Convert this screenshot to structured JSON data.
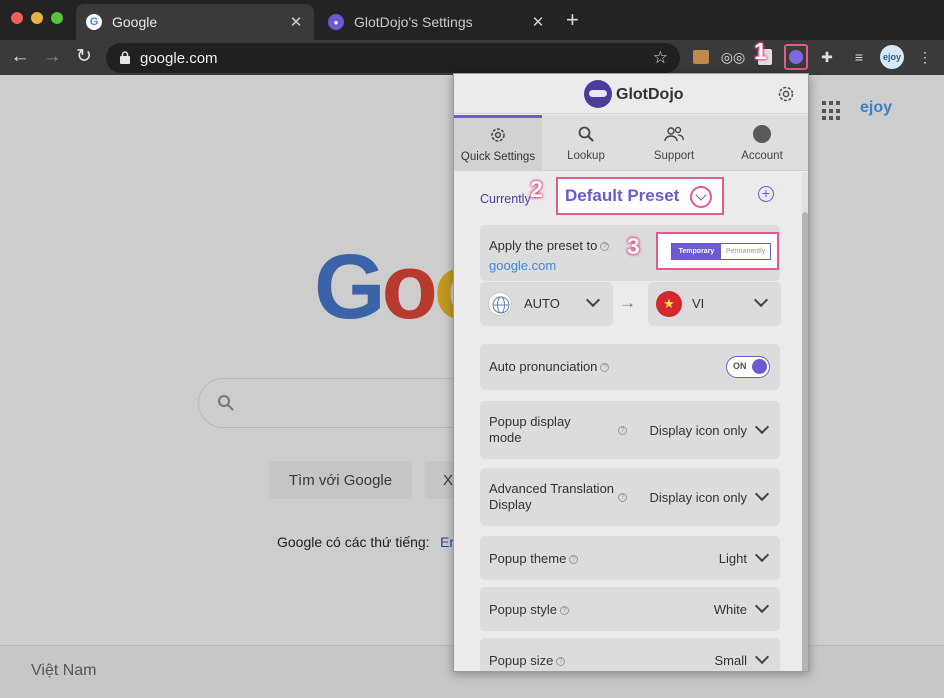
{
  "browser": {
    "tabs": [
      {
        "title": "Google",
        "favicon": "google-g-icon",
        "active": true
      },
      {
        "title": "GlotDojo's Settings",
        "favicon": "glotdojo-ninja-icon",
        "active": false
      }
    ],
    "new_tab_symbol": "+",
    "tab_close_symbol": "✕",
    "address": "google.com",
    "star_symbol": "☆",
    "avatar_text": "ejoy",
    "annotations": {
      "step1": "1",
      "step2": "2",
      "step3": "3"
    }
  },
  "google": {
    "logo_letters": [
      "G",
      "o",
      "o"
    ],
    "search_button": "Tìm với Google",
    "second_button_partial": "X",
    "languages_prefix": "Google có các thứ tiếng:",
    "languages_partial": "Er",
    "footer_country": "Việt Nam",
    "corner_badge": "ejoy"
  },
  "popup": {
    "brand": "GlotDojo",
    "tabs": [
      {
        "label": "Quick Settings",
        "icon": "gear-icon"
      },
      {
        "label": "Lookup",
        "icon": "search-icon"
      },
      {
        "label": "Support",
        "icon": "people-icon"
      },
      {
        "label": "Account",
        "icon": "account-icon"
      }
    ],
    "current_label": "Currently",
    "preset_name": "Default Preset",
    "apply_label": "Apply the preset to",
    "apply_site": "google.com",
    "scope_options": [
      "Temporary",
      "Permanently"
    ],
    "scope_selected": "Temporary",
    "source_language": "AUTO",
    "target_language": "VI",
    "arrow_symbol": "→",
    "flag_symbol": "★",
    "auto_pronunciation_label": "Auto pronunciation",
    "auto_pronunciation_state": "ON",
    "settings": [
      {
        "label": "Popup display mode",
        "value": "Display icon only"
      },
      {
        "label": "Advanced Translation Display",
        "value": "Display icon only"
      },
      {
        "label": "Popup theme",
        "value": "Light"
      },
      {
        "label": "Popup style",
        "value": "White"
      },
      {
        "label": "Popup size",
        "value": "Small"
      }
    ],
    "help_symbol": "?",
    "plus_symbol": "+"
  },
  "colors": {
    "accent": "#6b5bd2",
    "highlight": "#e25a8e",
    "link": "#3f8ad6"
  }
}
